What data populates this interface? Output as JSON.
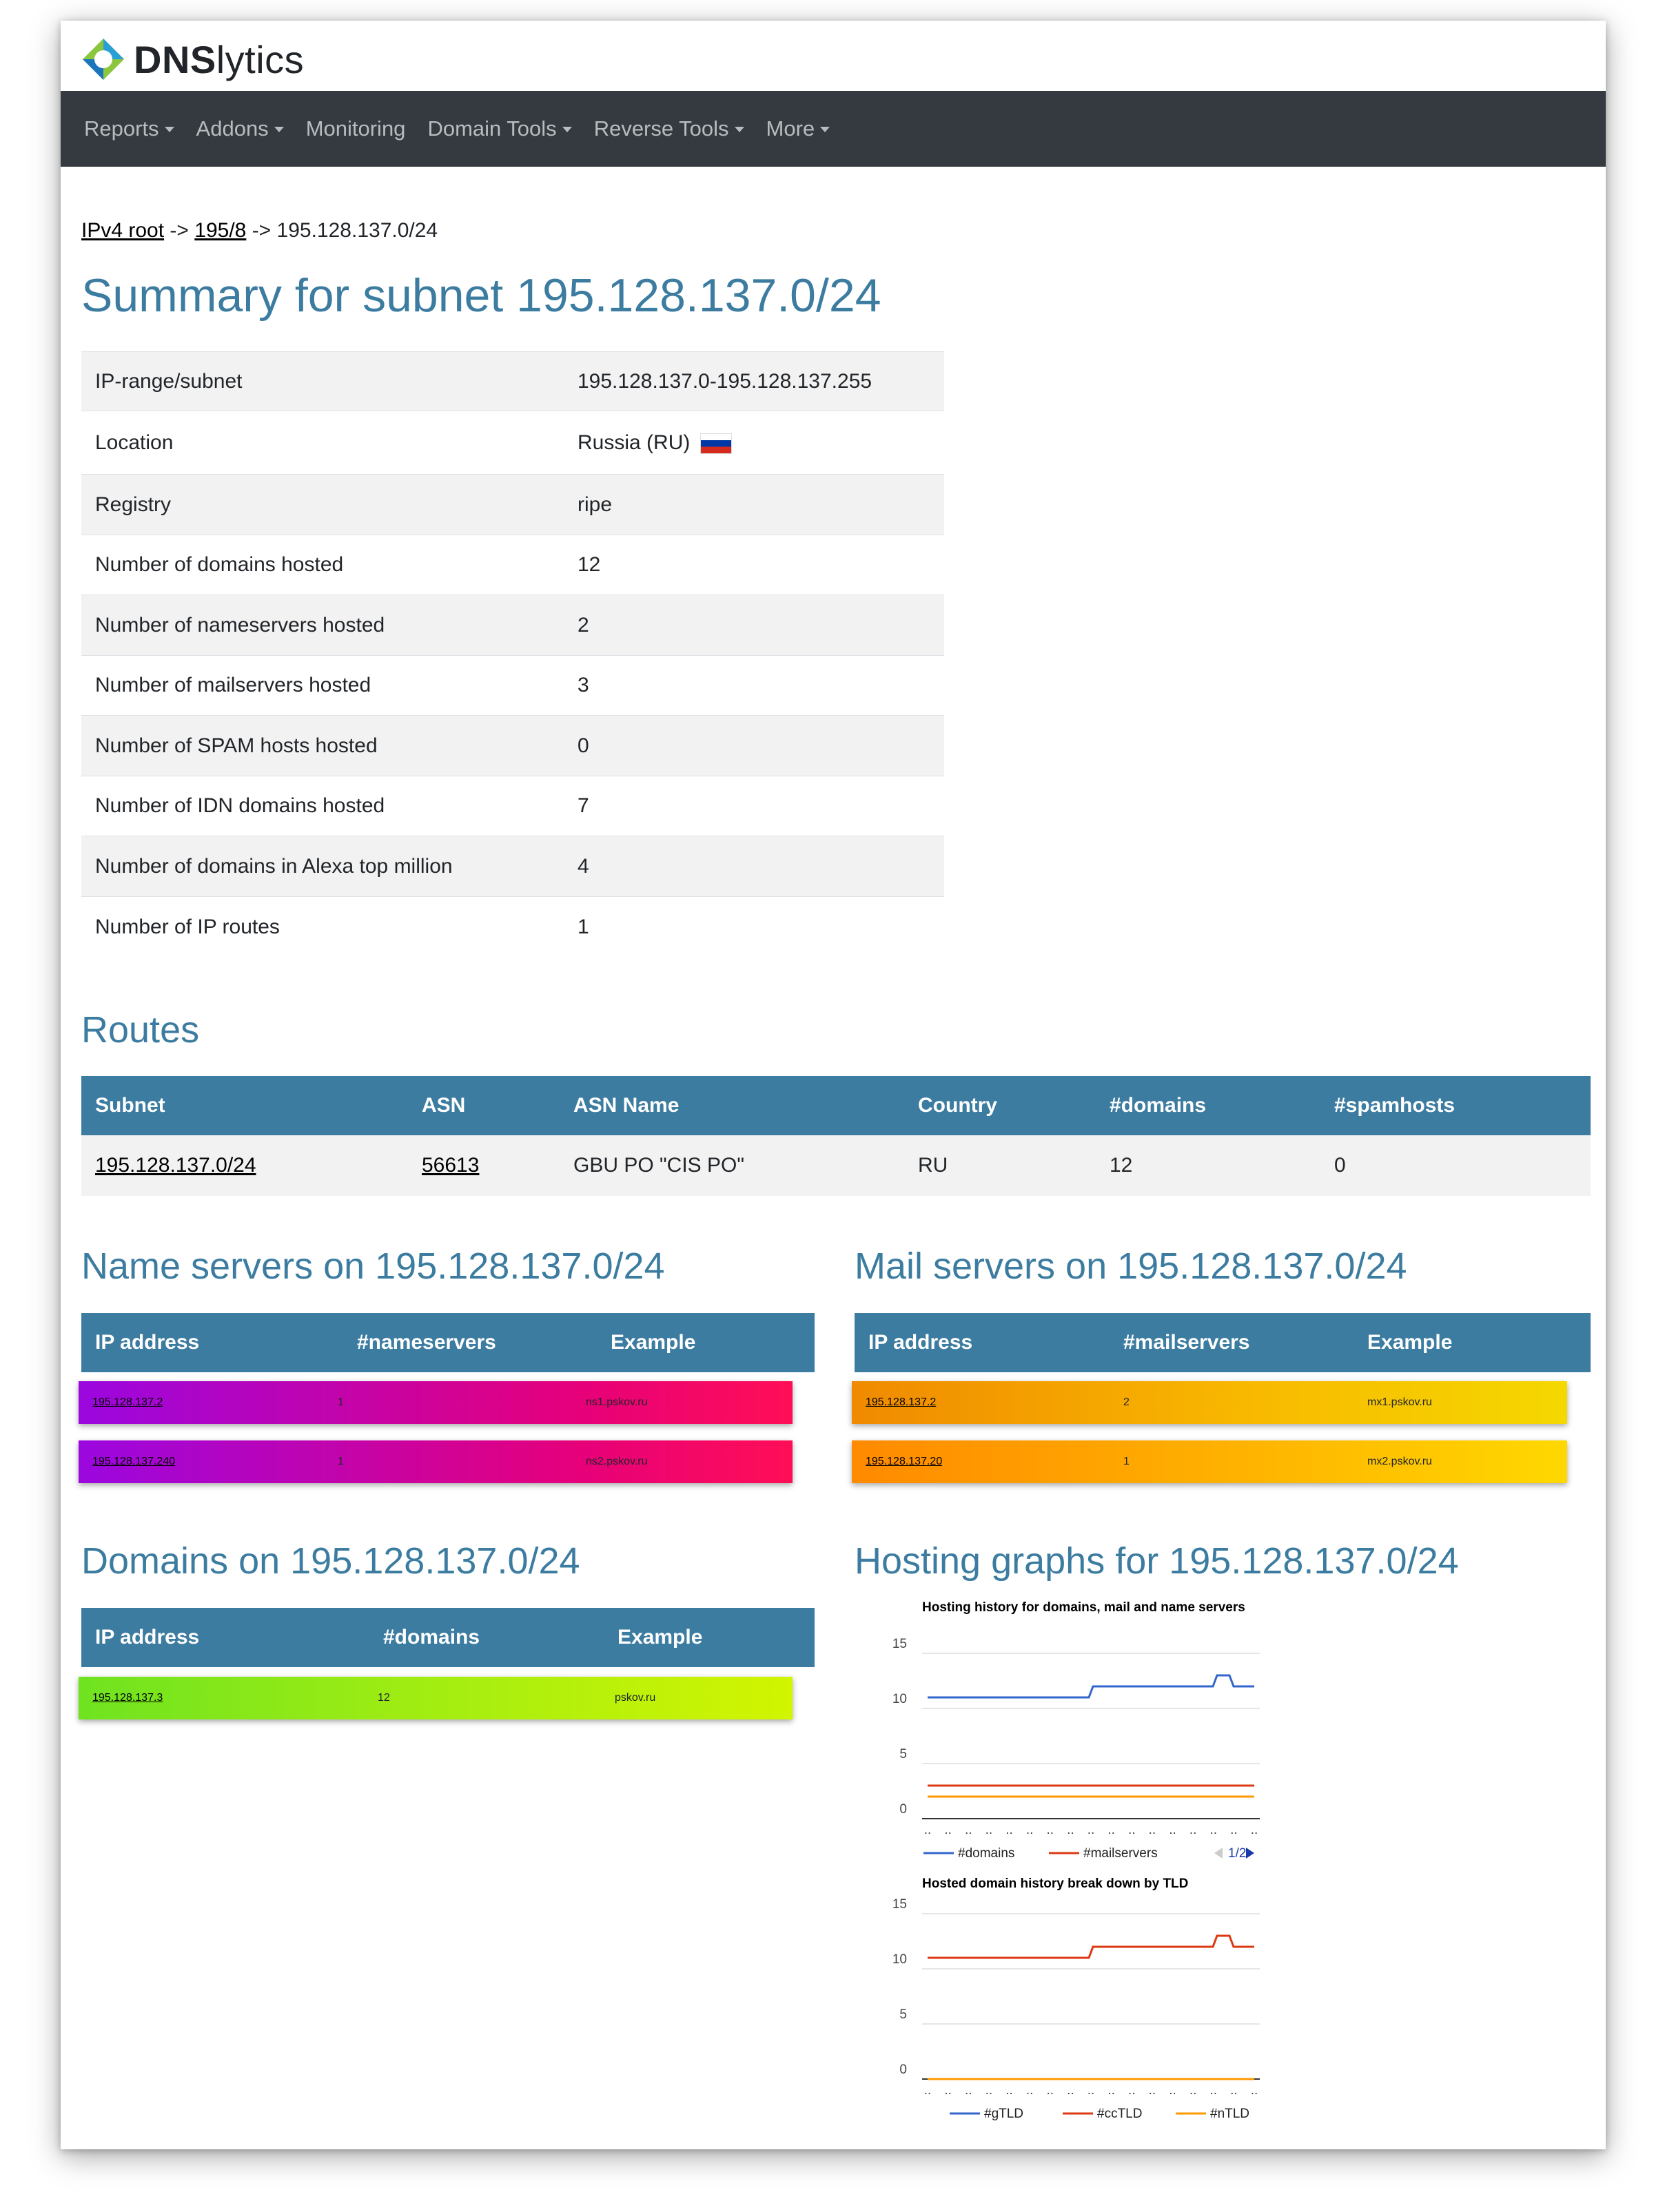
{
  "brand": {
    "name_bold": "DNS",
    "name_rest": "lytics"
  },
  "nav": [
    {
      "label": "Reports",
      "dropdown": true
    },
    {
      "label": "Addons",
      "dropdown": true
    },
    {
      "label": "Monitoring",
      "dropdown": false
    },
    {
      "label": "Domain Tools",
      "dropdown": true
    },
    {
      "label": "Reverse Tools",
      "dropdown": true
    },
    {
      "label": "More",
      "dropdown": true
    }
  ],
  "breadcrumb": {
    "root": "IPv4 root",
    "sep": "->",
    "parent": "195/8",
    "current": "195.128.137.0/24"
  },
  "summary": {
    "title": "Summary for subnet 195.128.137.0/24",
    "rows": [
      {
        "label": "IP-range/subnet",
        "value": "195.128.137.0-195.128.137.255"
      },
      {
        "label": "Location",
        "value": "Russia (RU)",
        "flag": true
      },
      {
        "label": "Registry",
        "value": "ripe"
      },
      {
        "label": "Number of domains hosted",
        "value": "12"
      },
      {
        "label": "Number of nameservers hosted",
        "value": "2"
      },
      {
        "label": "Number of mailservers hosted",
        "value": "3"
      },
      {
        "label": "Number of SPAM hosts hosted",
        "value": "0"
      },
      {
        "label": "Number of IDN domains hosted",
        "value": "7"
      },
      {
        "label": "Number of domains in Alexa top million",
        "value": "4"
      },
      {
        "label": "Number of IP routes",
        "value": "1"
      }
    ]
  },
  "routes": {
    "title": "Routes",
    "headers": [
      "Subnet",
      "ASN",
      "ASN Name",
      "Country",
      "#domains",
      "#spamhosts"
    ],
    "rows": [
      [
        "195.128.137.0/24",
        "56613",
        "GBU PO \"CIS PO\"",
        "RU",
        "12",
        "0"
      ]
    ]
  },
  "nameservers": {
    "title": "Name servers on 195.128.137.0/24",
    "headers": [
      "IP address",
      "#nameservers",
      "Example"
    ],
    "rows": [
      [
        "195.128.137.2",
        "1",
        "ns1.pskov.ru"
      ],
      [
        "195.128.137.240",
        "1",
        "ns2.pskov.ru"
      ]
    ]
  },
  "mailservers": {
    "title": "Mail servers on 195.128.137.0/24",
    "headers": [
      "IP address",
      "#mailservers",
      "Example"
    ],
    "rows": [
      [
        "195.128.137.2",
        "2",
        "mx1.pskov.ru"
      ],
      [
        "195.128.137.20",
        "1",
        "mx2.pskov.ru"
      ]
    ]
  },
  "domains": {
    "title": "Domains on 195.128.137.0/24",
    "headers": [
      "IP address",
      "#domains",
      "Example"
    ],
    "rows": [
      [
        "195.128.137.3",
        "12",
        "pskov.ru"
      ]
    ]
  },
  "graphs": {
    "title": "Hosting graphs for 195.128.137.0/24",
    "pager": "1/2",
    "colors": {
      "blue": "#3366cc",
      "red": "#dc3912",
      "orange": "#ff9900"
    },
    "chart_data": [
      {
        "type": "line",
        "title": "Hosting history for domains, mail and name servers",
        "ylim": [
          0,
          15
        ],
        "yticks": [
          0,
          5,
          10,
          15
        ],
        "legend_position": "bottom",
        "series": [
          {
            "name": "#domains",
            "values": [
              11,
              11,
              11,
              11,
              11,
              11,
              11,
              11,
              11,
              11,
              11,
              11,
              11,
              11,
              11,
              11,
              11,
              11,
              11,
              11,
              11,
              11,
              11,
              11,
              11,
              11,
              11,
              11,
              11,
              11,
              11,
              11,
              11,
              11,
              11,
              11,
              11,
              11,
              11,
              11,
              12,
              12,
              12,
              12,
              12,
              12,
              12,
              12,
              12,
              12,
              12,
              12,
              12,
              12,
              12,
              12,
              12,
              12,
              12,
              12,
              12,
              12,
              12,
              12,
              12,
              12,
              12,
              12,
              12,
              12,
              13,
              13,
              13,
              13,
              12,
              12,
              12,
              12,
              12,
              12
            ]
          },
          {
            "name": "#mailservers",
            "values": [
              3,
              3,
              3,
              3,
              3,
              3,
              3,
              3,
              3,
              3,
              3,
              3,
              3,
              3,
              3,
              3,
              3,
              3,
              3,
              3,
              3,
              3,
              3,
              3,
              3,
              3,
              3,
              3,
              3,
              3,
              3,
              3,
              3,
              3,
              3,
              3,
              3,
              3,
              3,
              3,
              3,
              3,
              3,
              3,
              3,
              3,
              3,
              3,
              3,
              3,
              3,
              3,
              3,
              3,
              3,
              3,
              3,
              3,
              3,
              3,
              3,
              3,
              3,
              3,
              3,
              3,
              3,
              3,
              3,
              3,
              3,
              3,
              3,
              3,
              3,
              3,
              3,
              3,
              3,
              3
            ]
          },
          {
            "name": "",
            "values": [
              2,
              2,
              2,
              2,
              2,
              2,
              2,
              2,
              2,
              2,
              2,
              2,
              2,
              2,
              2,
              2,
              2,
              2,
              2,
              2,
              2,
              2,
              2,
              2,
              2,
              2,
              2,
              2,
              2,
              2,
              2,
              2,
              2,
              2,
              2,
              2,
              2,
              2,
              2,
              2,
              2,
              2,
              2,
              2,
              2,
              2,
              2,
              2,
              2,
              2,
              2,
              2,
              2,
              2,
              2,
              2,
              2,
              2,
              2,
              2,
              2,
              2,
              2,
              2,
              2,
              2,
              2,
              2,
              2,
              2,
              2,
              2,
              2,
              2,
              2,
              2,
              2,
              2,
              2,
              2
            ]
          }
        ]
      },
      {
        "type": "line",
        "title": "Hosted domain history break down by TLD",
        "ylim": [
          0,
          15
        ],
        "yticks": [
          0,
          5,
          10,
          15
        ],
        "legend_position": "bottom",
        "series": [
          {
            "name": "#gTLD",
            "values": [
              0,
              0,
              0,
              0,
              0,
              0,
              0,
              0,
              0,
              0,
              0,
              0,
              0,
              0,
              0,
              0,
              0,
              0,
              0,
              0,
              0,
              0,
              0,
              0,
              0,
              0,
              0,
              0,
              0,
              0,
              0,
              0,
              0,
              0,
              0,
              0,
              0,
              0,
              0,
              0,
              0,
              0,
              0,
              0,
              0,
              0,
              0,
              0,
              0,
              0,
              0,
              0,
              0,
              0,
              0,
              0,
              0,
              0,
              0,
              0,
              0,
              0,
              0,
              0,
              0,
              0,
              0,
              0,
              0,
              0,
              0,
              0,
              0,
              0,
              0,
              0,
              0,
              0,
              0,
              0
            ]
          },
          {
            "name": "#ccTLD",
            "values": [
              11,
              11,
              11,
              11,
              11,
              11,
              11,
              11,
              11,
              11,
              11,
              11,
              11,
              11,
              11,
              11,
              11,
              11,
              11,
              11,
              11,
              11,
              11,
              11,
              11,
              11,
              11,
              11,
              11,
              11,
              11,
              11,
              11,
              11,
              11,
              11,
              11,
              11,
              11,
              11,
              12,
              12,
              12,
              12,
              12,
              12,
              12,
              12,
              12,
              12,
              12,
              12,
              12,
              12,
              12,
              12,
              12,
              12,
              12,
              12,
              12,
              12,
              12,
              12,
              12,
              12,
              12,
              12,
              12,
              12,
              13,
              13,
              13,
              13,
              12,
              12,
              12,
              12,
              12,
              12
            ]
          },
          {
            "name": "#nTLD",
            "values": [
              0,
              0,
              0,
              0,
              0,
              0,
              0,
              0,
              0,
              0,
              0,
              0,
              0,
              0,
              0,
              0,
              0,
              0,
              0,
              0,
              0,
              0,
              0,
              0,
              0,
              0,
              0,
              0,
              0,
              0,
              0,
              0,
              0,
              0,
              0,
              0,
              0,
              0,
              0,
              0,
              0,
              0,
              0,
              0,
              0,
              0,
              0,
              0,
              0,
              0,
              0,
              0,
              0,
              0,
              0,
              0,
              0,
              0,
              0,
              0,
              0,
              0,
              0,
              0,
              0,
              0,
              0,
              0,
              0,
              0,
              0,
              0,
              0,
              0,
              0,
              0,
              0,
              0,
              0,
              0
            ]
          }
        ]
      }
    ]
  }
}
